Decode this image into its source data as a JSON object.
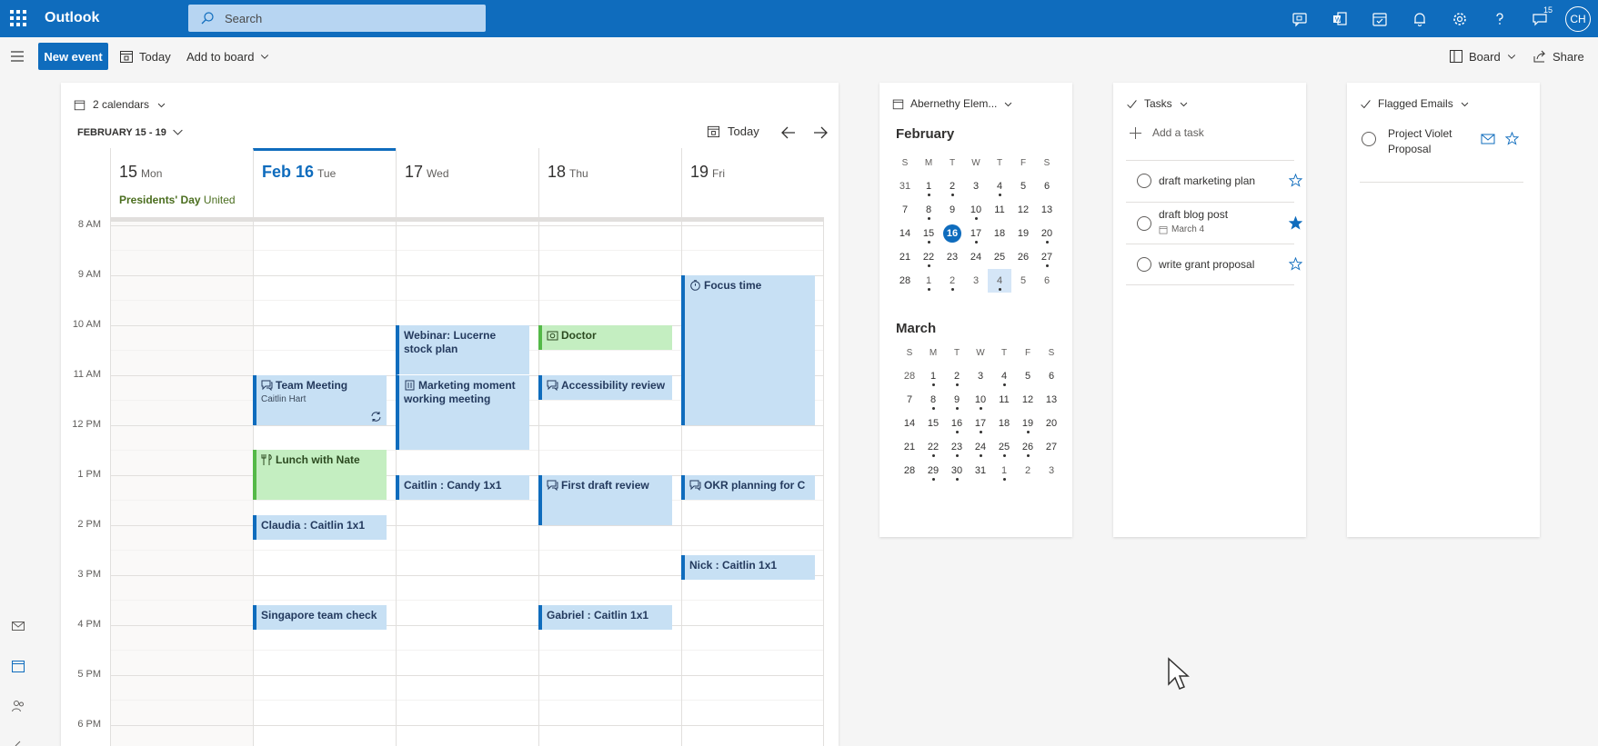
{
  "app": {
    "name": "Outlook"
  },
  "search": {
    "placeholder": "Search"
  },
  "topbar": {
    "icons": [
      "meet-now-icon",
      "office-icon",
      "my-day-icon",
      "bell-icon",
      "gear-icon",
      "help-icon",
      "feedback-icon"
    ],
    "feedback_badge": "15",
    "avatar_initials": "CH"
  },
  "cmdbar": {
    "new_event": "New event",
    "today": "Today",
    "add_to_board": "Add to board",
    "board": "Board",
    "share": "Share"
  },
  "calendar": {
    "calendars_label": "2 calendars",
    "range_label": "FEBRUARY 15 - 19",
    "today_btn": "Today",
    "days": [
      {
        "num": "15",
        "name": "Mon",
        "holiday": "Presidents' Day",
        "holiday_extra": "United"
      },
      {
        "num": "Feb 16",
        "name": "Tue",
        "today": true
      },
      {
        "num": "17",
        "name": "Wed"
      },
      {
        "num": "18",
        "name": "Thu"
      },
      {
        "num": "19",
        "name": "Fri"
      }
    ],
    "hours": [
      "8 AM",
      "9 AM",
      "10 AM",
      "11 AM",
      "12 PM",
      "1 PM",
      "2 PM",
      "3 PM",
      "4 PM",
      "5 PM",
      "6 PM"
    ],
    "events": [
      {
        "title": "Team Meeting",
        "sub": "Caitlin Hart",
        "icon": "chat-icon"
      },
      {
        "title": "Lunch with Nate",
        "icon": "dining-icon"
      },
      {
        "title": "Claudia : Caitlin 1x1"
      },
      {
        "title": "Singapore team check"
      },
      {
        "title": "Webinar: Lucerne stock plan"
      },
      {
        "title": "Marketing moment working meeting",
        "icon": "building-icon"
      },
      {
        "title": "Caitlin : Candy 1x1"
      },
      {
        "title": "Doctor",
        "icon": "camera-icon"
      },
      {
        "title": "Accessibility review",
        "icon": "chat-icon"
      },
      {
        "title": "First draft review",
        "icon": "chat-icon"
      },
      {
        "title": "Gabriel : Caitlin 1x1"
      },
      {
        "title": "Focus time",
        "icon": "timer-icon"
      },
      {
        "title": "OKR planning for C",
        "icon": "chat-icon"
      },
      {
        "title": "Nick : Caitlin 1x1"
      }
    ]
  },
  "mini_calendar": {
    "title": "Abernethy Elem...",
    "weekdays": [
      "S",
      "M",
      "T",
      "W",
      "T",
      "F",
      "S"
    ],
    "feb": {
      "label": "February",
      "days": [
        "31",
        "1",
        "2",
        "3",
        "4",
        "5",
        "6",
        "7",
        "8",
        "9",
        "10",
        "11",
        "12",
        "13",
        "14",
        "15",
        "16",
        "17",
        "18",
        "19",
        "20",
        "21",
        "22",
        "23",
        "24",
        "25",
        "26",
        "27",
        "28",
        "1",
        "2",
        "3",
        "4",
        "5",
        "6"
      ]
    },
    "mar": {
      "label": "March",
      "days": [
        "28",
        "1",
        "2",
        "3",
        "4",
        "5",
        "6",
        "7",
        "8",
        "9",
        "10",
        "11",
        "12",
        "13",
        "14",
        "15",
        "16",
        "17",
        "18",
        "19",
        "20",
        "21",
        "22",
        "23",
        "24",
        "25",
        "26",
        "27",
        "28",
        "29",
        "30",
        "31",
        "1",
        "2",
        "3"
      ]
    }
  },
  "tasks": {
    "title": "Tasks",
    "add": "Add a task",
    "items": [
      {
        "title": "draft marketing plan",
        "starred": false
      },
      {
        "title": "draft blog post",
        "due": "March 4",
        "starred": true
      },
      {
        "title": "write grant proposal",
        "starred": false
      }
    ]
  },
  "flagged": {
    "title": "Flagged Emails",
    "items": [
      {
        "title": "Project Violet Proposal"
      }
    ]
  },
  "colors": {
    "brand": "#0f6cbd",
    "event_blue": "#c7e0f4",
    "event_green": "#c4eec1"
  }
}
